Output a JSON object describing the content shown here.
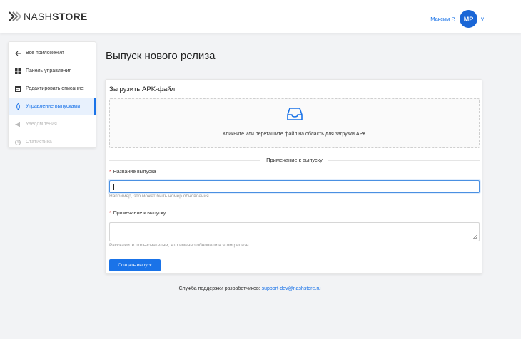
{
  "header": {
    "logo_light": "NASH",
    "logo_bold": "STORE",
    "user_name": "Максим Р.",
    "avatar_initials": "МР",
    "caret": "v"
  },
  "sidebar": {
    "items": [
      {
        "label": "Все приложения",
        "icon": "arrow-left-icon",
        "state": "normal"
      },
      {
        "label": "Панель управления",
        "icon": "dashboard-grid-icon",
        "state": "normal"
      },
      {
        "label": "Редактировать описание",
        "icon": "edit-doc-icon",
        "state": "normal"
      },
      {
        "label": "Управление выпусками",
        "icon": "rocket-icon",
        "state": "active"
      },
      {
        "label": "Уведомления",
        "icon": "megaphone-icon",
        "state": "disabled"
      },
      {
        "label": "Статистика",
        "icon": "stats-icon",
        "state": "disabled"
      }
    ]
  },
  "page": {
    "title": "Выпуск нового релиза"
  },
  "card": {
    "title": "Загрузить APK-файл",
    "upload_text": "Кликните или перетащите файл на область для загрузки APK",
    "divider": "Примечание к выпуску",
    "name_label": "Название выпуска",
    "name_value": "",
    "name_help": "Например, это может быть номер обновления",
    "notes_label": "Примечание к выпуску",
    "notes_help": "Расскажите пользователям, что именно обновили в этом релизе",
    "submit": "Создать выпуск",
    "required_mark": "*"
  },
  "footer": {
    "text": "Служба поддержки разработчиков:",
    "email": "support-dev@nashstore.ru"
  },
  "colors": {
    "accent": "#1a73e8",
    "avatar": "#1a66d6",
    "active_bg": "#e8f1fd",
    "required": "#e04040"
  }
}
